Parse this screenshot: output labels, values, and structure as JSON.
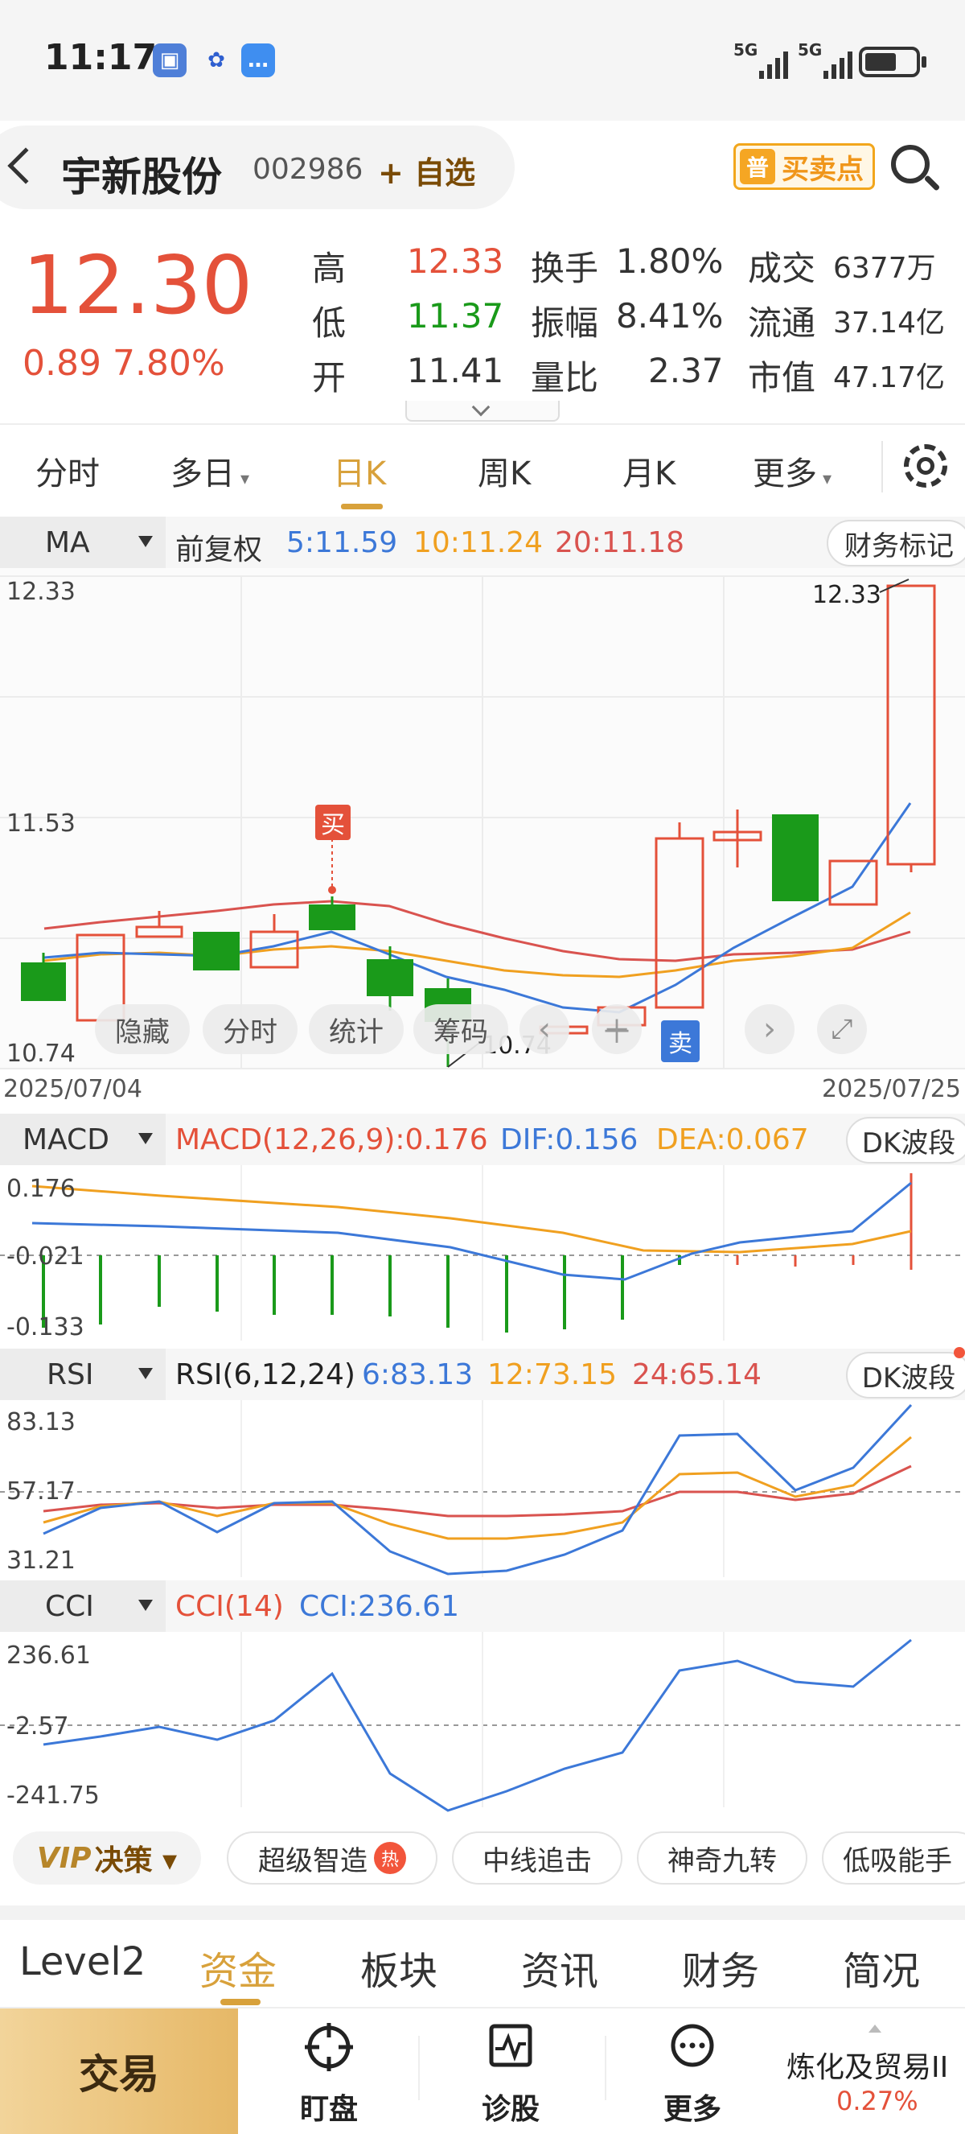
{
  "status": {
    "time": "11:17",
    "net1": "5G",
    "net2": "5G"
  },
  "header": {
    "name": "宇新股份",
    "code": "002986",
    "add_watch": "+ 自选",
    "buysell_tag": "普",
    "buysell": "买卖点"
  },
  "quote": {
    "price": "12.30",
    "change": "0.89 7.80%",
    "high_label": "高",
    "high": "12.33",
    "low_label": "低",
    "low": "11.37",
    "open_label": "开",
    "open": "11.41",
    "turnover_label": "换手",
    "turnover": "1.80%",
    "amplitude_label": "振幅",
    "amplitude": "8.41%",
    "vol_ratio_label": "量比",
    "vol_ratio": "2.37",
    "deal_label": "成交",
    "deal": "6377万",
    "float_label": "流通",
    "float_cap": "37.14亿",
    "mcap_label": "市值",
    "mcap": "47.17亿"
  },
  "tabs": [
    "分时",
    "多日",
    "日K",
    "周K",
    "月K",
    "更多"
  ],
  "active_tab": "日K",
  "kline": {
    "indicator": "MA",
    "adjust": "前复权",
    "ma5": "5:11.59",
    "ma10": "10:11.24",
    "ma20": "20:11.18",
    "finance_mark": "财务标记",
    "y_top": "12.33",
    "y_mid": "11.53",
    "y_bottom": "10.74",
    "high_note": "12.33",
    "low_note": "10.74",
    "buy_tag": "买",
    "sell_tag": "卖",
    "date_start": "2025/07/04",
    "date_end": "2025/07/25",
    "controls": [
      "隐藏",
      "分时",
      "统计",
      "筹码"
    ]
  },
  "macd": {
    "selector": "MACD",
    "title": "MACD(12,26,9):0.176",
    "dif": "DIF:0.156",
    "dea": "DEA:0.067",
    "button": "DK波段",
    "y_top": "0.176",
    "y_mid": "-0.021",
    "y_bottom": "-0.133"
  },
  "rsi": {
    "selector": "RSI",
    "title": "RSI(6,12,24)",
    "r6": "6:83.13",
    "r12": "12:73.15",
    "r24": "24:65.14",
    "button": "DK波段",
    "y_top": "83.13",
    "y_mid": "57.17",
    "y_bottom": "31.21"
  },
  "cci": {
    "selector": "CCI",
    "title": "CCI(14)",
    "value": "CCI:236.61",
    "y_top": "236.61",
    "y_mid": "-2.57",
    "y_bottom": "-241.75"
  },
  "strategies": {
    "vip_logo": "VIP",
    "vip_label": "决策 ▾",
    "items": [
      "超级智造",
      "中线追击",
      "神奇九转",
      "低吸能手"
    ],
    "hot_badge": "热"
  },
  "bottom_tabs": [
    "Level2",
    "资金",
    "板块",
    "资讯",
    "财务",
    "简况"
  ],
  "active_bottom_tab": "资金",
  "bottom_bar": {
    "trade": "交易",
    "watch": "盯盘",
    "diagnose": "诊股",
    "more": "更多",
    "sector_name": "炼化及贸易II",
    "sector_pct": "0.27%"
  },
  "colors": {
    "up": "#e4513a",
    "down": "#1a9a1a",
    "ma5": "#3c78d8",
    "ma10": "#f0a020",
    "ma20": "#d9534f",
    "accent": "#d8a13b"
  }
}
